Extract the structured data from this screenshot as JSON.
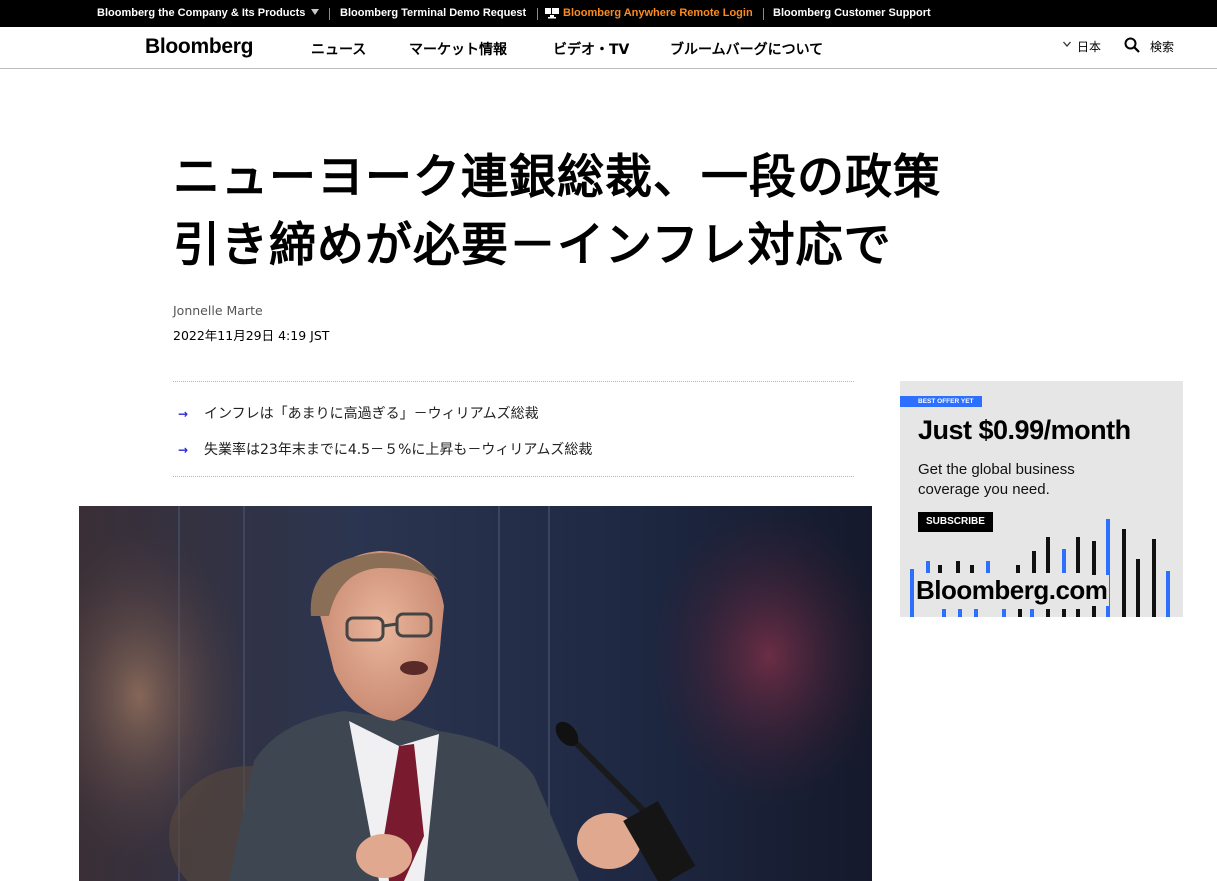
{
  "topbar": {
    "company": "Bloomberg the Company & Its Products",
    "terminal_demo": "Bloomberg Terminal Demo Request",
    "anywhere_login": "Bloomberg Anywhere Remote Login",
    "support": "Bloomberg Customer Support",
    "accent_color": "#fb8b1e"
  },
  "nav": {
    "logo": "Bloomberg",
    "links": [
      "ニュース",
      "マーケット情報",
      "ビデオ・TV",
      "ブルームバーグについて"
    ],
    "region": "日本",
    "search": "検索"
  },
  "article": {
    "headline_line1": "ニューヨーク連銀総裁、一段の政策",
    "headline_line2": "引き締めが必要－インフレ対応で",
    "author": "Jonnelle Marte",
    "date": "2022年11月29日 4:19 JST",
    "bullets": [
      "インフレは「あまりに高過ぎる」－ウィリアムズ総裁",
      "失業率は23年末までに4.5－５%に上昇も－ウィリアムズ総裁"
    ],
    "bullet_arrow": "→",
    "bullet_color": "#2a27d6"
  },
  "ad": {
    "badge": "BEST OFFER YET",
    "price": "Just $0.99/month",
    "copy": "Get the global business coverage you need.",
    "button": "SUBSCRIBE",
    "brand": "Bloomberg.com",
    "accent_color": "#2d6fff"
  }
}
